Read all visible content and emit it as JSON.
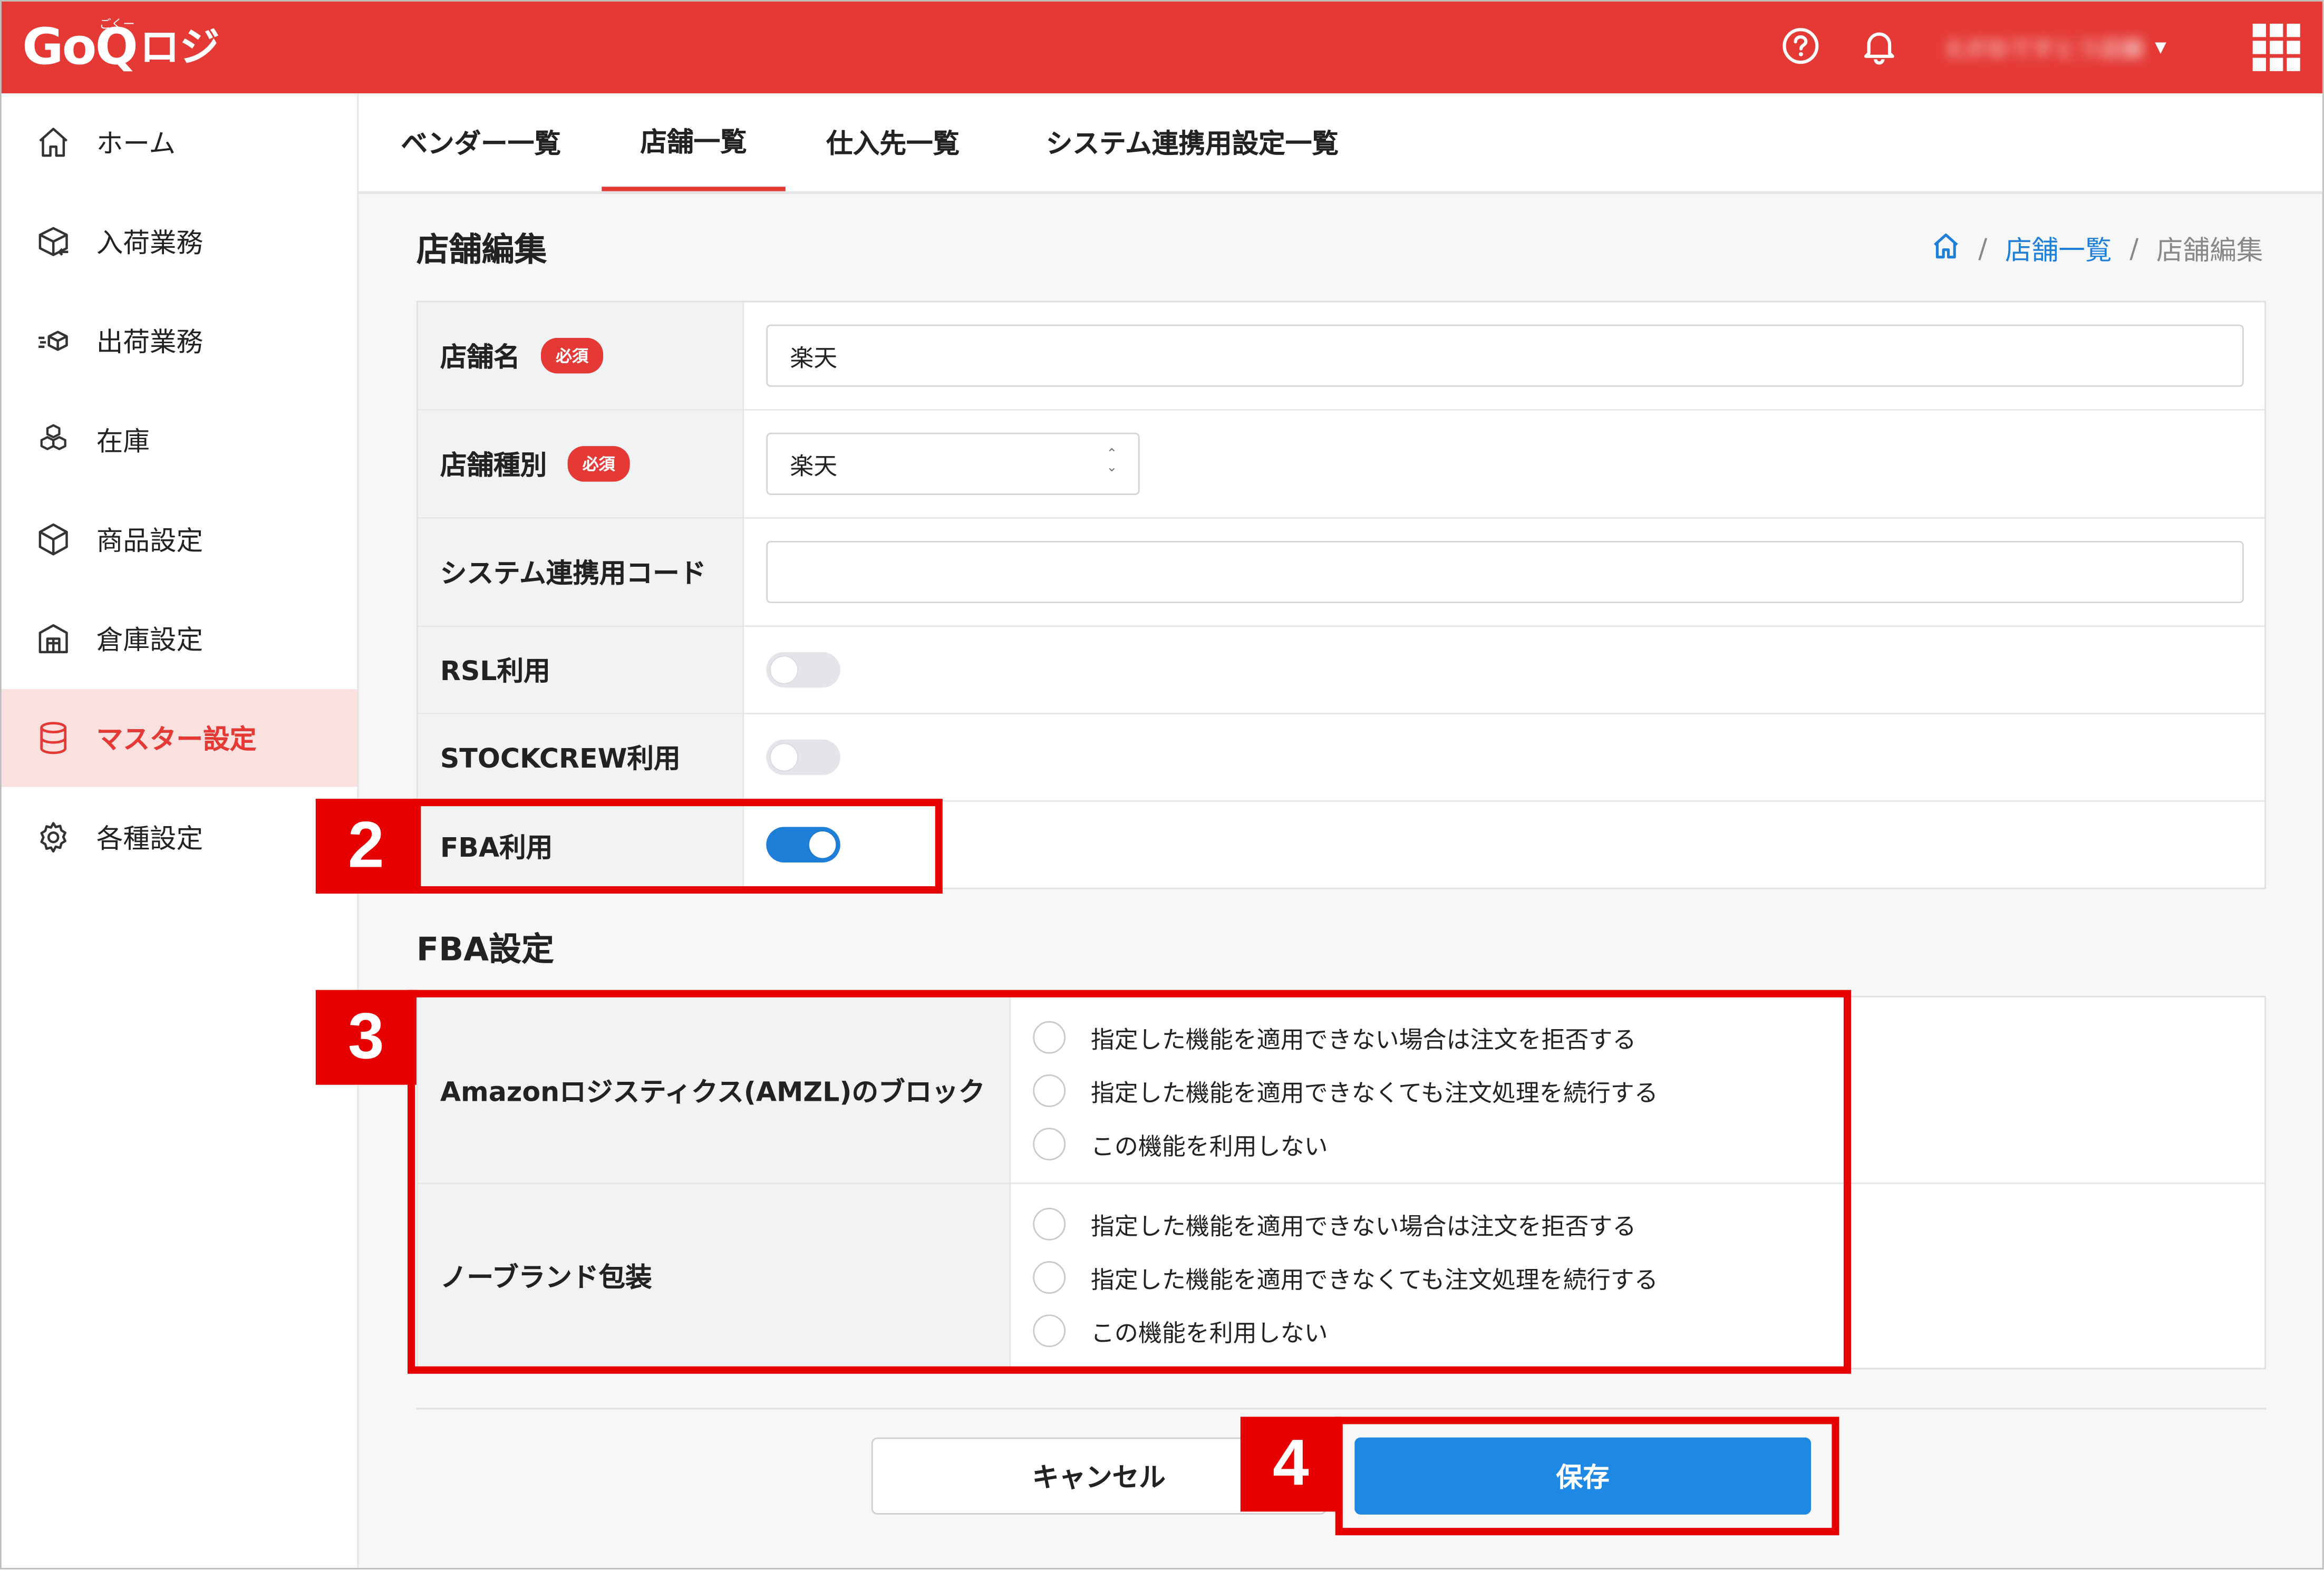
{
  "header": {
    "logo_text": "GoQ",
    "logo_kana": "ロジ",
    "logo_ruby": "ごくー",
    "user_name": "えがおですとう店舗",
    "bg_color": "#e53935"
  },
  "sidebar": {
    "items": [
      {
        "label": "ホーム",
        "icon": "home-icon"
      },
      {
        "label": "入荷業務",
        "icon": "box-arrow-in-icon"
      },
      {
        "label": "出荷業務",
        "icon": "box-fast-icon"
      },
      {
        "label": "在庫",
        "icon": "boxes-icon"
      },
      {
        "label": "商品設定",
        "icon": "cube-icon"
      },
      {
        "label": "倉庫設定",
        "icon": "warehouse-icon"
      },
      {
        "label": "マスター設定",
        "icon": "database-icon",
        "active": true
      },
      {
        "label": "各種設定",
        "icon": "gear-icon"
      }
    ],
    "active_color": "#e53935"
  },
  "tabs": [
    {
      "label": "ベンダー一覧"
    },
    {
      "label": "店舗一覧",
      "active": true
    },
    {
      "label": "仕入先一覧"
    },
    {
      "label": "システム連携用設定一覧"
    }
  ],
  "page": {
    "title": "店舗編集",
    "breadcrumb": {
      "link": "店舗一覧",
      "current": "店舗編集",
      "sep": "/"
    }
  },
  "form": {
    "required_label": "必須",
    "store_name": {
      "label": "店舗名",
      "value": "楽天"
    },
    "store_type": {
      "label": "店舗種別",
      "value": "楽天"
    },
    "system_code": {
      "label": "システム連携用コード",
      "value": ""
    },
    "rsl": {
      "label": "RSL利用",
      "enabled": false
    },
    "stockcrew": {
      "label": "STOCKCREW利用",
      "enabled": false
    },
    "fba": {
      "label": "FBA利用",
      "enabled": true
    }
  },
  "fba_settings": {
    "title": "FBA設定",
    "rows": [
      {
        "label": "Amazonロジスティクス(AMZL)のブロック",
        "options": [
          "指定した機能を適用できない場合は注文を拒否する",
          "指定した機能を適用できなくても注文処理を続行する",
          "この機能を利用しない"
        ]
      },
      {
        "label": "ノーブランド包装",
        "options": [
          "指定した機能を適用できない場合は注文を拒否する",
          "指定した機能を適用できなくても注文処理を続行する",
          "この機能を利用しない"
        ]
      }
    ]
  },
  "actions": {
    "cancel": "キャンセル",
    "save": "保存",
    "save_color": "#1e88e5"
  },
  "callouts": {
    "step2": "2",
    "step3": "3",
    "step4": "4",
    "color": "#e60000"
  }
}
